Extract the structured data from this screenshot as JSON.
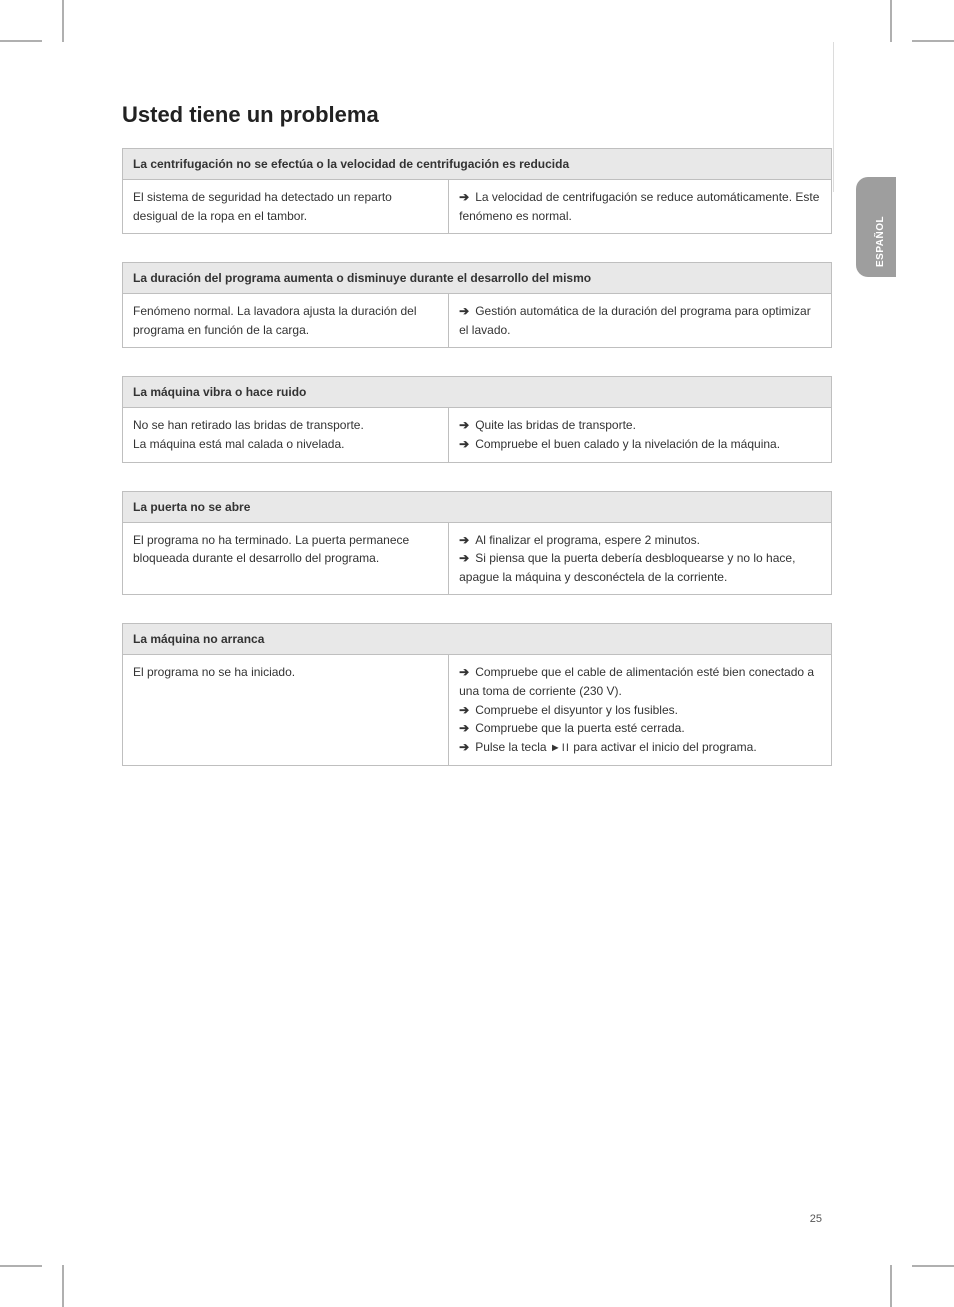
{
  "page": {
    "title": "Usted tiene un problema",
    "number": "25",
    "side_tab": "ESPAÑOL"
  },
  "sections": [
    {
      "header": "La centrifugación no se efectúa o la velocidad de centrifugación es reducida",
      "rows": [
        {
          "cause": "El sistema de seguridad ha detectado un reparto desigual de la ropa en el tambor.",
          "fix": "La velocidad de centrifugación se reduce automáticamente. Este fenómeno es normal."
        }
      ]
    },
    {
      "header": "La duración del programa aumenta o disminuye durante el desarrollo del mismo",
      "rows": [
        {
          "cause": "Fenómeno normal. La lavadora ajusta la duración del programa en función de la carga.",
          "fix": "Gestión automática de la duración del programa para optimizar el lavado."
        }
      ]
    },
    {
      "header": "La máquina vibra o hace ruido",
      "rows": [
        {
          "cause": "No se han retirado las bridas de transporte.\nLa máquina está mal calada o nivelada.",
          "fix": "Quite las bridas de transporte.\nCompruebe el buen calado y la nivelación de la máquina."
        }
      ]
    },
    {
      "header": "La puerta no se abre",
      "rows": [
        {
          "cause": "El programa no ha terminado. La puerta permanece bloqueada durante el desarrollo del programa.",
          "fix": "Al finalizar el programa, espere 2 minutos. Si piensa que la puerta debería desbloquearse y no lo hace, apague la máquina y desconéctela de la corriente."
        }
      ]
    },
    {
      "header": "La máquina no arranca",
      "rows": [
        {
          "cause": "El programa no se ha iniciado.",
          "fix_lines": [
            "Compruebe que el cable de alimentación esté bien conectado a una toma de corriente (230 V).",
            "Compruebe el disyuntor y los fusibles.",
            "Compruebe que la puerta esté cerrada.",
            "Pulse la tecla ▶II para activar el inicio del programa."
          ]
        }
      ]
    }
  ]
}
